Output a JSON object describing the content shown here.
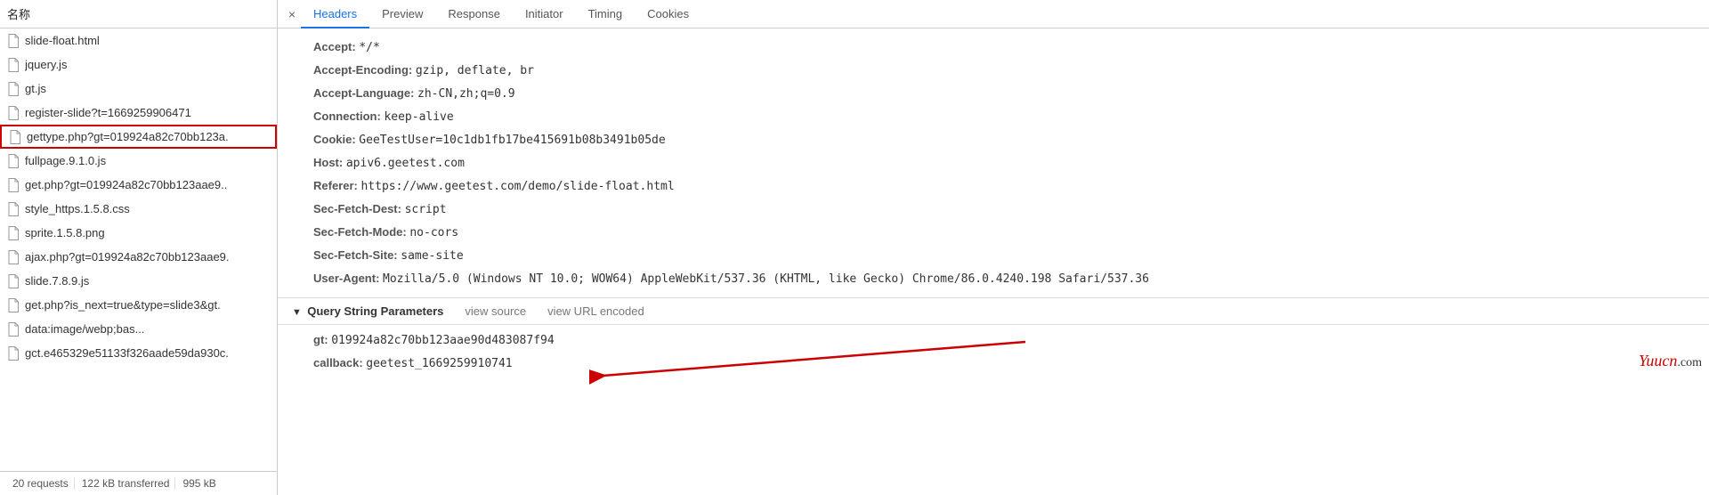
{
  "left": {
    "header": "名称",
    "files": [
      {
        "name": "slide-float.html",
        "highlight": false
      },
      {
        "name": "jquery.js",
        "highlight": false
      },
      {
        "name": "gt.js",
        "highlight": false
      },
      {
        "name": "register-slide?t=1669259906471",
        "highlight": false
      },
      {
        "name": "gettype.php?gt=019924a82c70bb123a.",
        "highlight": true
      },
      {
        "name": "fullpage.9.1.0.js",
        "highlight": false
      },
      {
        "name": "get.php?gt=019924a82c70bb123aae9..",
        "highlight": false
      },
      {
        "name": "style_https.1.5.8.css",
        "highlight": false
      },
      {
        "name": "sprite.1.5.8.png",
        "highlight": false
      },
      {
        "name": "ajax.php?gt=019924a82c70bb123aae9.",
        "highlight": false
      },
      {
        "name": "slide.7.8.9.js",
        "highlight": false
      },
      {
        "name": "get.php?is_next=true&type=slide3&gt.",
        "highlight": false
      },
      {
        "name": "data:image/webp;bas...",
        "highlight": false
      },
      {
        "name": "gct.e465329e51133f326aade59da930c.",
        "highlight": false
      }
    ],
    "footer": {
      "requests": "20 requests",
      "transferred": "122 kB transferred",
      "resources": "995 kB"
    }
  },
  "tabs": {
    "items": [
      "Headers",
      "Preview",
      "Response",
      "Initiator",
      "Timing",
      "Cookies"
    ],
    "active": 0
  },
  "headers": [
    {
      "key": "Accept:",
      "val": "*/*"
    },
    {
      "key": "Accept-Encoding:",
      "val": "gzip, deflate, br"
    },
    {
      "key": "Accept-Language:",
      "val": "zh-CN,zh;q=0.9"
    },
    {
      "key": "Connection:",
      "val": "keep-alive"
    },
    {
      "key": "Cookie:",
      "val": "GeeTestUser=10c1db1fb17be415691b08b3491b05de"
    },
    {
      "key": "Host:",
      "val": "apiv6.geetest.com"
    },
    {
      "key": "Referer:",
      "val": "https://www.geetest.com/demo/slide-float.html"
    },
    {
      "key": "Sec-Fetch-Dest:",
      "val": "script"
    },
    {
      "key": "Sec-Fetch-Mode:",
      "val": "no-cors"
    },
    {
      "key": "Sec-Fetch-Site:",
      "val": "same-site"
    },
    {
      "key": "User-Agent:",
      "val": "Mozilla/5.0 (Windows NT 10.0; WOW64) AppleWebKit/537.36 (KHTML, like Gecko) Chrome/86.0.4240.198 Safari/537.36"
    }
  ],
  "querySection": {
    "title": "Query String Parameters",
    "link1": "view source",
    "link2": "view URL encoded",
    "params": [
      {
        "key": "gt:",
        "val": "019924a82c70bb123aae90d483087f94"
      },
      {
        "key": "callback:",
        "val": "geetest_1669259910741"
      }
    ]
  },
  "watermark": {
    "brand": "Yuucn",
    "suffix": ".com"
  }
}
